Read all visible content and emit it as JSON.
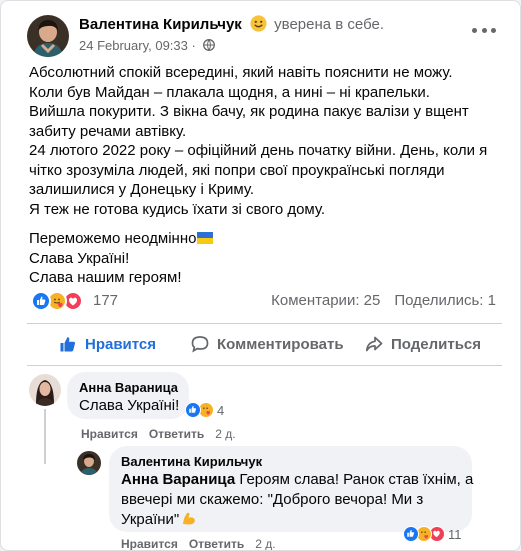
{
  "post": {
    "author": "Валентина Кирильчук",
    "feeling_icon": "smiling-face-emoji",
    "feeling": "уверена в себе.",
    "time": "24 February, 09:33 ·",
    "audience_icon": "globe-icon",
    "lines": [
      "Абсолютний спокій всередині, який навіть пояснити не можу.",
      "Коли був Майдан – плакала щодня, а нині – ні крапельки.",
      "Вийшла покурити. З вікна бачу, як родина пакує валізи у вщент",
      "забиту речами автівку.",
      "24 лютого 2022 року – офіційний день початку війни. День, коли я",
      "чітко зрозуміла людей, які попри свої проукраїнські погляди",
      "залишилися у Донецьку і Криму.",
      "Я теж не готова кудись їхати зі свого дому."
    ],
    "closing_lines": [
      "Переможемо неодмінно",
      "Слава Україні!",
      "Слава нашим героям!"
    ],
    "closing_flag_icon": "ukraine-flag-emoji"
  },
  "reactions": {
    "icons": [
      "like-reaction-icon",
      "care-reaction-icon",
      "love-reaction-icon"
    ],
    "count": "177",
    "comments": "Коментарии: 25",
    "shares": "Поделились: 1"
  },
  "actions": {
    "like": "Нравится",
    "comment": "Комментировать",
    "share": "Поделиться"
  },
  "comments": [
    {
      "author": "Анна Вараница",
      "text": "Слава Україні!",
      "reaction_count": "4",
      "like_label": "Нравится",
      "reply_label": "Ответить",
      "time": "2 д."
    },
    {
      "author": "Валентина Кирильчук",
      "tag": "Анна Вараница",
      "line1": "Героям слава! Ранок став їхнім, а",
      "line2": "ввечері ми скажемо: \"Доброго вечора! Ми з",
      "line3": "України\"",
      "emoji_icon": "flexed-biceps-emoji",
      "reaction_count": "11",
      "like_label": "Нравится",
      "reply_label": "Ответить",
      "time": "2 д."
    }
  ],
  "colors": {
    "like_blue": "#216fdb",
    "love_red": "#f33e58",
    "care_yellow": "#f7b125",
    "secondary_text": "#65676b"
  }
}
